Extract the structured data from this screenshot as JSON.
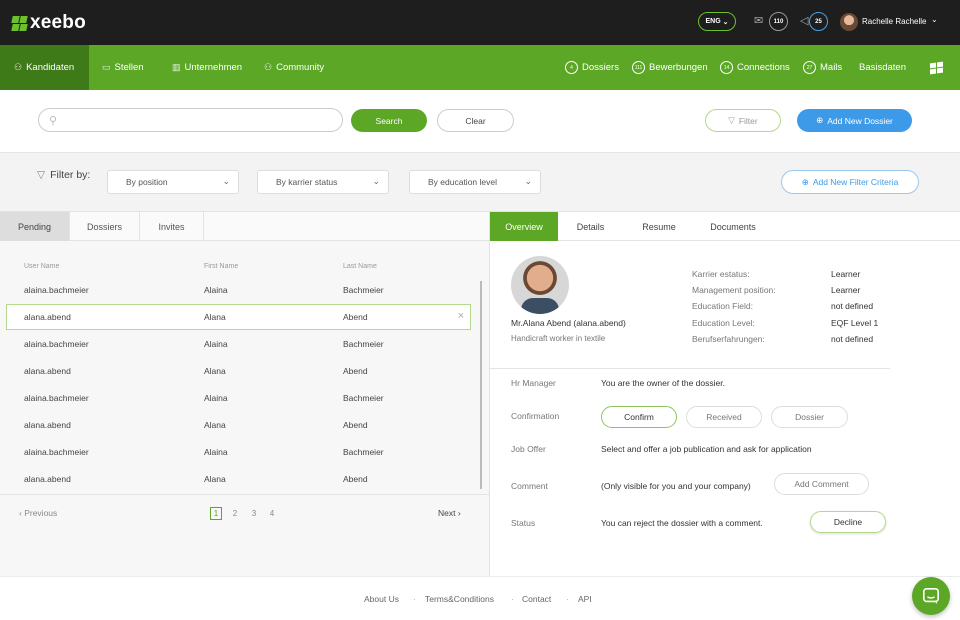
{
  "app": {
    "brand": "xeebo",
    "language": "ENG",
    "mail_count": "110",
    "notification_count": "25",
    "user_name": "Rachelle Rachelle"
  },
  "nav": {
    "left": [
      "Kandidaten",
      "Stellen",
      "Unternehmen",
      "Community"
    ],
    "right": [
      {
        "count": "4",
        "label": "Dossiers"
      },
      {
        "count": "111",
        "label": "Bewerbungen"
      },
      {
        "count": "14",
        "label": "Connections"
      },
      {
        "count": "27",
        "label": "Mails"
      },
      {
        "count": "",
        "label": "Basisdaten"
      }
    ]
  },
  "search": {
    "value": "",
    "placeholder": "",
    "search_label": "Search",
    "clear_label": "Clear",
    "filter_label": "Filter",
    "add_dossier_label": "Add New Dossier"
  },
  "filters": {
    "label": "Filter by:",
    "position": "By position",
    "karrier_status": "By karrier status",
    "education_level": "By education level",
    "add_criteria_label": "Add New Filter Criteria"
  },
  "left_tabs": [
    "Pending",
    "Dossiers",
    "Invites"
  ],
  "table": {
    "headers": [
      "User Name",
      "First Name",
      "Last Name"
    ],
    "rows": [
      [
        "alaina.bachmeier",
        "Alaina",
        "Bachmeier"
      ],
      [
        "alana.abend",
        "Alana",
        "Abend"
      ],
      [
        "alaina.bachmeier",
        "Alaina",
        "Bachmeier"
      ],
      [
        "alana.abend",
        "Alana",
        "Abend"
      ],
      [
        "alaina.bachmeier",
        "Alaina",
        "Bachmeier"
      ],
      [
        "alana.abend",
        "Alana",
        "Abend"
      ],
      [
        "alaina.bachmeier",
        "Alaina",
        "Bachmeier"
      ],
      [
        "alana.abend",
        "Alana",
        "Abend"
      ]
    ],
    "selected_row": 1
  },
  "pagination": {
    "previous_label": "Previous",
    "next_label": "Next",
    "pages": [
      "1",
      "2",
      "3",
      "4"
    ],
    "current": "1"
  },
  "right_tabs": [
    "Overview",
    "Details",
    "Resume",
    "Documents"
  ],
  "profile": {
    "name": "Mr.Alana Abend (alana.abend)",
    "subtitle": "Handicraft worker in textile",
    "info": [
      {
        "label": "Karrier estatus:",
        "value": "Learner"
      },
      {
        "label": "Management position:",
        "value": "Learner"
      },
      {
        "label": "Education Field:",
        "value": "not defined"
      },
      {
        "label": "Education Level:",
        "value": "EQF Level 1"
      },
      {
        "label": "Berufserfahrungen:",
        "value": "not defined"
      }
    ]
  },
  "dossier": {
    "hr_manager_label": "Hr Manager",
    "hr_manager_text": "You are the owner of the dossier.",
    "confirmation_label": "Confirmation",
    "confirm_label": "Confirm",
    "received_label": "Received",
    "dossier_label": "Dossier",
    "job_offer_label": "Job Offer",
    "job_offer_text": "Select and offer a job publication and ask for application",
    "comment_label": "Comment",
    "comment_text": "(Only visible for you and your company)",
    "add_comment_label": "Add Comment",
    "status_label": "Status",
    "status_text": "You can reject the dossier with a comment.",
    "decline_label": "Decline"
  },
  "footer": [
    "About Us",
    "Terms&Conditions",
    "Contact",
    "API"
  ],
  "colors": {
    "brand_green": "#5ca826",
    "dark_green": "#3f7a18",
    "accent_blue": "#3c9ae8",
    "topbar": "#1e1e1e"
  }
}
